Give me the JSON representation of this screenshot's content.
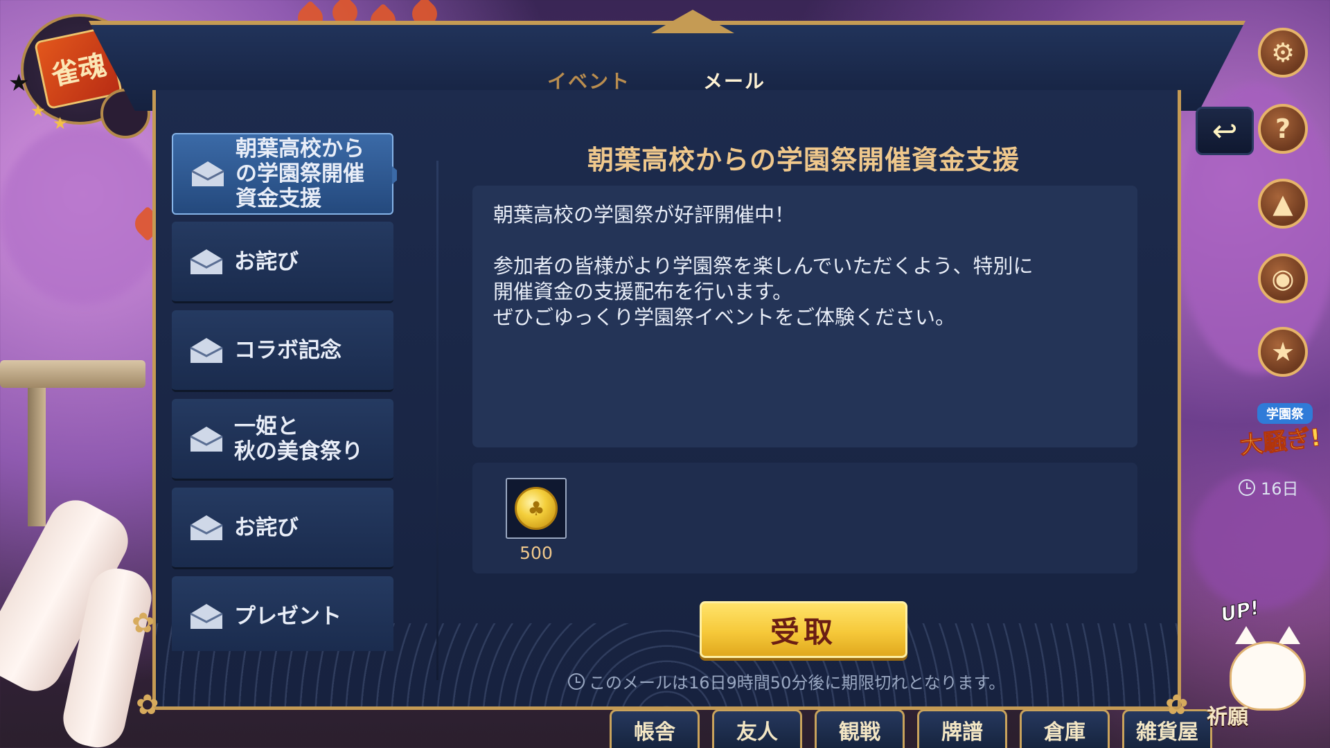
{
  "top_tabs": {
    "event": "イベント",
    "mail": "メール"
  },
  "mail_list": [
    {
      "title": "朝葉高校から\nの学園祭開催\n資金支援",
      "selected": true
    },
    {
      "title": "お詫び",
      "selected": false
    },
    {
      "title": "コラボ記念",
      "selected": false
    },
    {
      "title": "一姫と\n秋の美食祭り",
      "selected": false
    },
    {
      "title": "お詫び",
      "selected": false
    },
    {
      "title": "プレゼント",
      "selected": false
    }
  ],
  "mail_detail": {
    "heading": "朝葉高校からの学園祭開催資金支援",
    "body": "朝葉高校の学園祭が好評開催中！\n\n参加者の皆様がより学園祭を楽しんでいただくよう、特別に\n開催資金の支援配布を行います。\nぜひごゆっくり学園祭イベントをご体験ください。",
    "reward": {
      "icon": "gold-coin-icon",
      "quantity": "500"
    },
    "claim_label": "受取",
    "expire_text": "このメールは16日9時間50分後に期限切れとなります。"
  },
  "side_panel": {
    "event_banner_small": "学園祭",
    "event_banner_big": "大騒ぎ!",
    "event_timer": "16日",
    "lucky_cat_label": "祈願",
    "up_badge": "UP!"
  },
  "bottom_tabs": [
    "帳舎",
    "友人",
    "観戦",
    "牌譜",
    "倉庫",
    "雑貨屋"
  ],
  "logo_text": "雀魂",
  "colors": {
    "panel_bg": "#1d2b4d",
    "gold_border": "#c59b54",
    "heading": "#f0c88c",
    "claim_button": "#f6c93a",
    "selected_item": "#3b6aa7"
  }
}
